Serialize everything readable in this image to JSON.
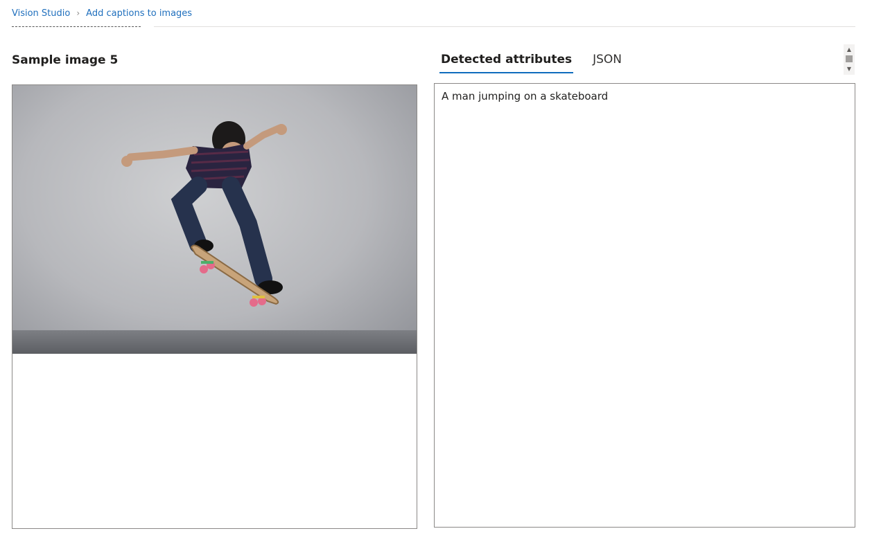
{
  "breadcrumb": {
    "root": "Vision Studio",
    "current": "Add captions to images"
  },
  "left_panel": {
    "title": "Sample image 5",
    "image_alt": "man jumping on a skateboard in front of concrete wall"
  },
  "right_panel": {
    "tabs": [
      {
        "label": "Detected attributes",
        "active": true
      },
      {
        "label": "JSON",
        "active": false
      }
    ],
    "caption": "A man jumping on a skateboard"
  },
  "icons": {
    "breadcrumb_separator": "chevron-right-icon",
    "scroll_up": "triangle-up-icon",
    "scroll_down": "triangle-down-icon"
  },
  "colors": {
    "link": "#1f6fbd",
    "tab_underline": "#0f6cbd",
    "border": "#8a8886"
  }
}
